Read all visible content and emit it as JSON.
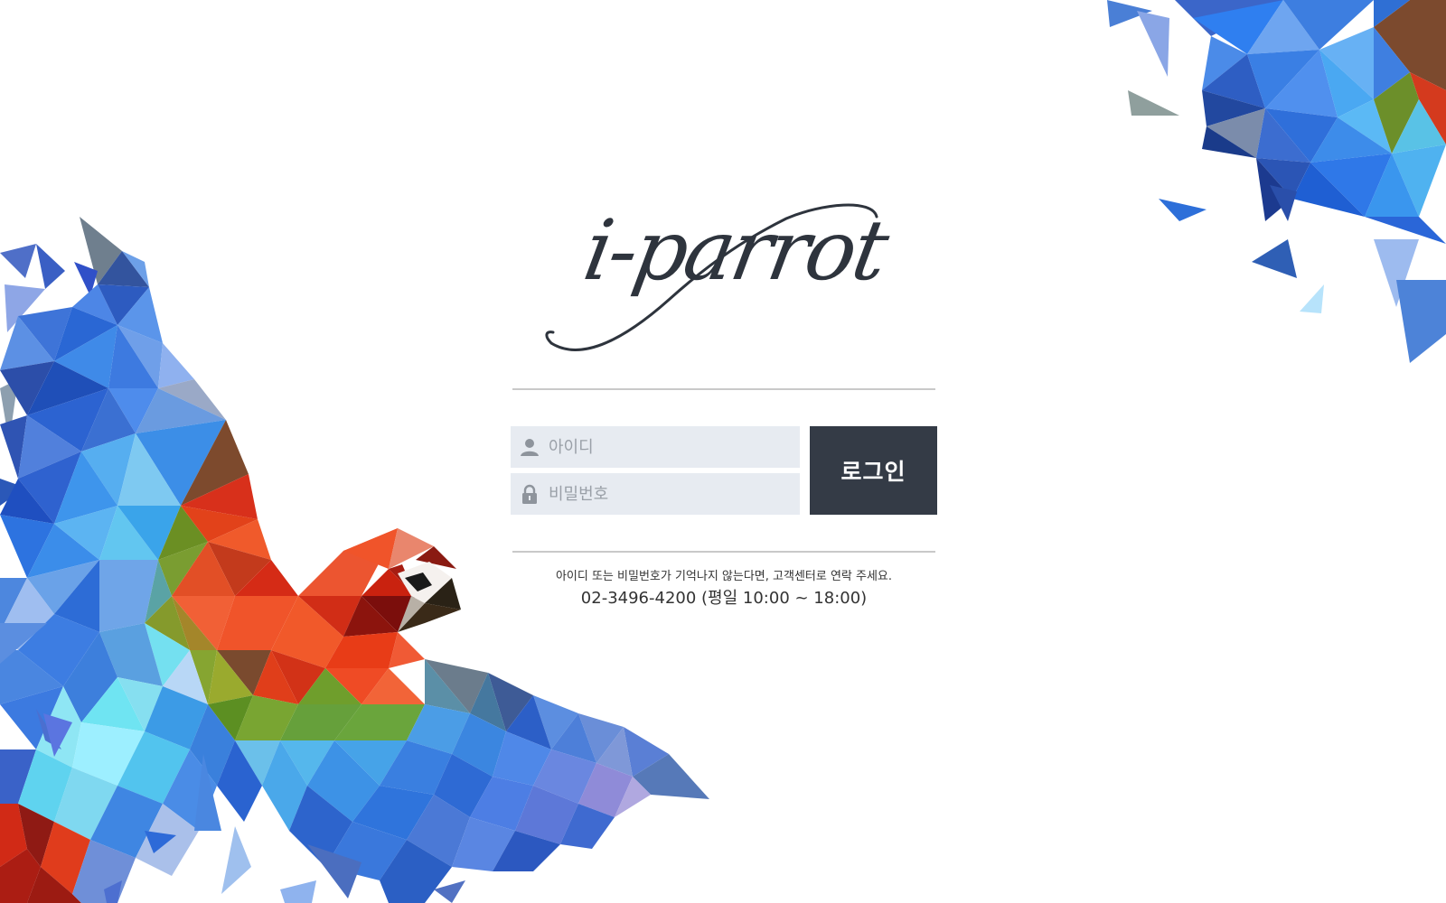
{
  "logo": {
    "text": "i-parrot"
  },
  "login": {
    "id_placeholder": "아이디",
    "password_placeholder": "비밀번호",
    "button_label": "로그인"
  },
  "help": {
    "message": "아이디 또는 비밀번호가 기억나지 않는다면, 고객센터로 연락 주세요.",
    "phone": "02-3496-4200 (평일 10:00 ~ 18:00)"
  },
  "icons": {
    "id_icon": "user-icon",
    "password_icon": "lock-icon"
  },
  "colors": {
    "button_bg": "#343b46",
    "field_bg": "#e7ebf1",
    "logo": "#2e343d"
  }
}
